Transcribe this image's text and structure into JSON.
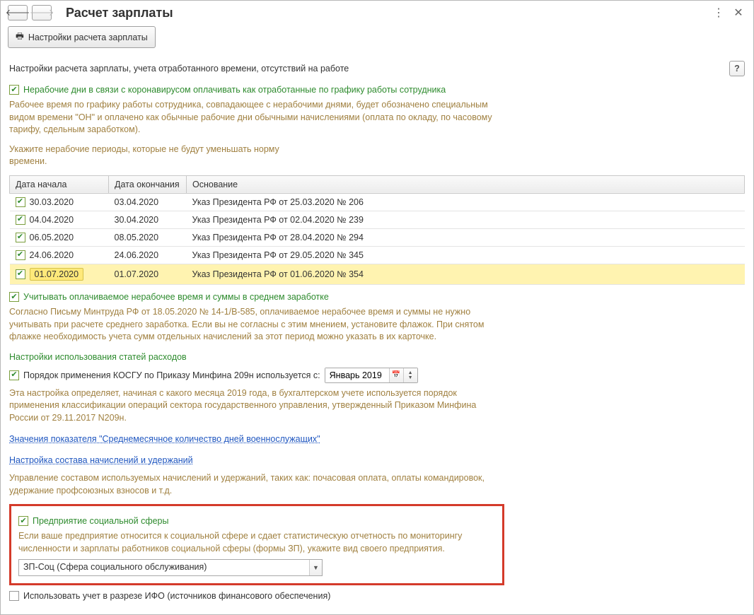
{
  "title": "Расчет зарплаты",
  "toolbar": {
    "settings_btn": "Настройки расчета зарплаты"
  },
  "subtitle": "Настройки расчета зарплаты, учета отработанного времени, отсутствий на работе",
  "help": "?",
  "covid_check": "Нерабочие дни в связи с коронавирусом оплачивать как отработанные по графику работы сотрудника",
  "covid_note": "Рабочее время по графику работы сотрудника, совпадающее с нерабочими днями, будет обозначено специальным видом времени \"ОН\" и оплачено как обычные рабочие дни обычными начислениями (оплата по окладу, по часовому тарифу, сдельным заработком).",
  "periods_note": "Укажите нерабочие периоды, которые не будут уменьшать норму времени.",
  "table": {
    "head_start": "Дата начала",
    "head_end": "Дата окончания",
    "head_base": "Основание",
    "rows": [
      {
        "start": "30.03.2020",
        "end": "03.04.2020",
        "base": "Указ Президента РФ от 25.03.2020 № 206"
      },
      {
        "start": "04.04.2020",
        "end": "30.04.2020",
        "base": "Указ Президента РФ от 02.04.2020 № 239"
      },
      {
        "start": "06.05.2020",
        "end": "08.05.2020",
        "base": "Указ Президента РФ от 28.04.2020 № 294"
      },
      {
        "start": "24.06.2020",
        "end": "24.06.2020",
        "base": "Указ Президента РФ от 29.05.2020 № 345"
      },
      {
        "start": "01.07.2020",
        "end": "01.07.2020",
        "base": "Указ Президента РФ от 01.06.2020 № 354"
      }
    ]
  },
  "avg_check": "Учитывать оплачиваемое нерабочее время и суммы в среднем заработке",
  "avg_note": "Согласно Письму Минтруда РФ от 18.05.2020 № 14-1/В-585, оплачиваемое нерабочее время и суммы не нужно учитывать при расчете среднего заработка. Если вы не согласны с этим мнением, установите флажок. При снятом флажке необходимость учета сумм отдельных начислений за этот период можно указать в их карточке.",
  "exp_section": "Настройки использования статей расходов",
  "kosgu_label": "Порядок применения КОСГУ по Приказу Минфина 209н используется с:",
  "kosgu_value": "Январь 2019",
  "kosgu_note": "Эта настройка определяет, начиная с какого месяца 2019 года, в бухгалтерском учете используется порядок применения классификации операций сектора государственного управления, утвержденный Приказом Минфина России от 29.11.2017 N209н.",
  "link1": "Значения показателя \"Среднемесячное количество дней военнослужащих\"",
  "link2": "Настройка состава начислений и удержаний",
  "link2_note": "Управление составом используемых начислений и удержаний, таких как: почасовая оплата, оплаты командировок, удержание профсоюзных взносов и т.д.",
  "social_check": "Предприятие социальной сферы",
  "social_note": "Если ваше предприятие относится к социальной сфере и сдает статистическую отчетность по мониторингу численности и зарплаты работников социальной сферы (формы ЗП), укажите вид своего предприятия.",
  "social_select": "ЗП-Соц (Сфера социального обслуживания)",
  "ifo_check": "Использовать учет в разрезе ИФО (источников финансового обеспечения)"
}
